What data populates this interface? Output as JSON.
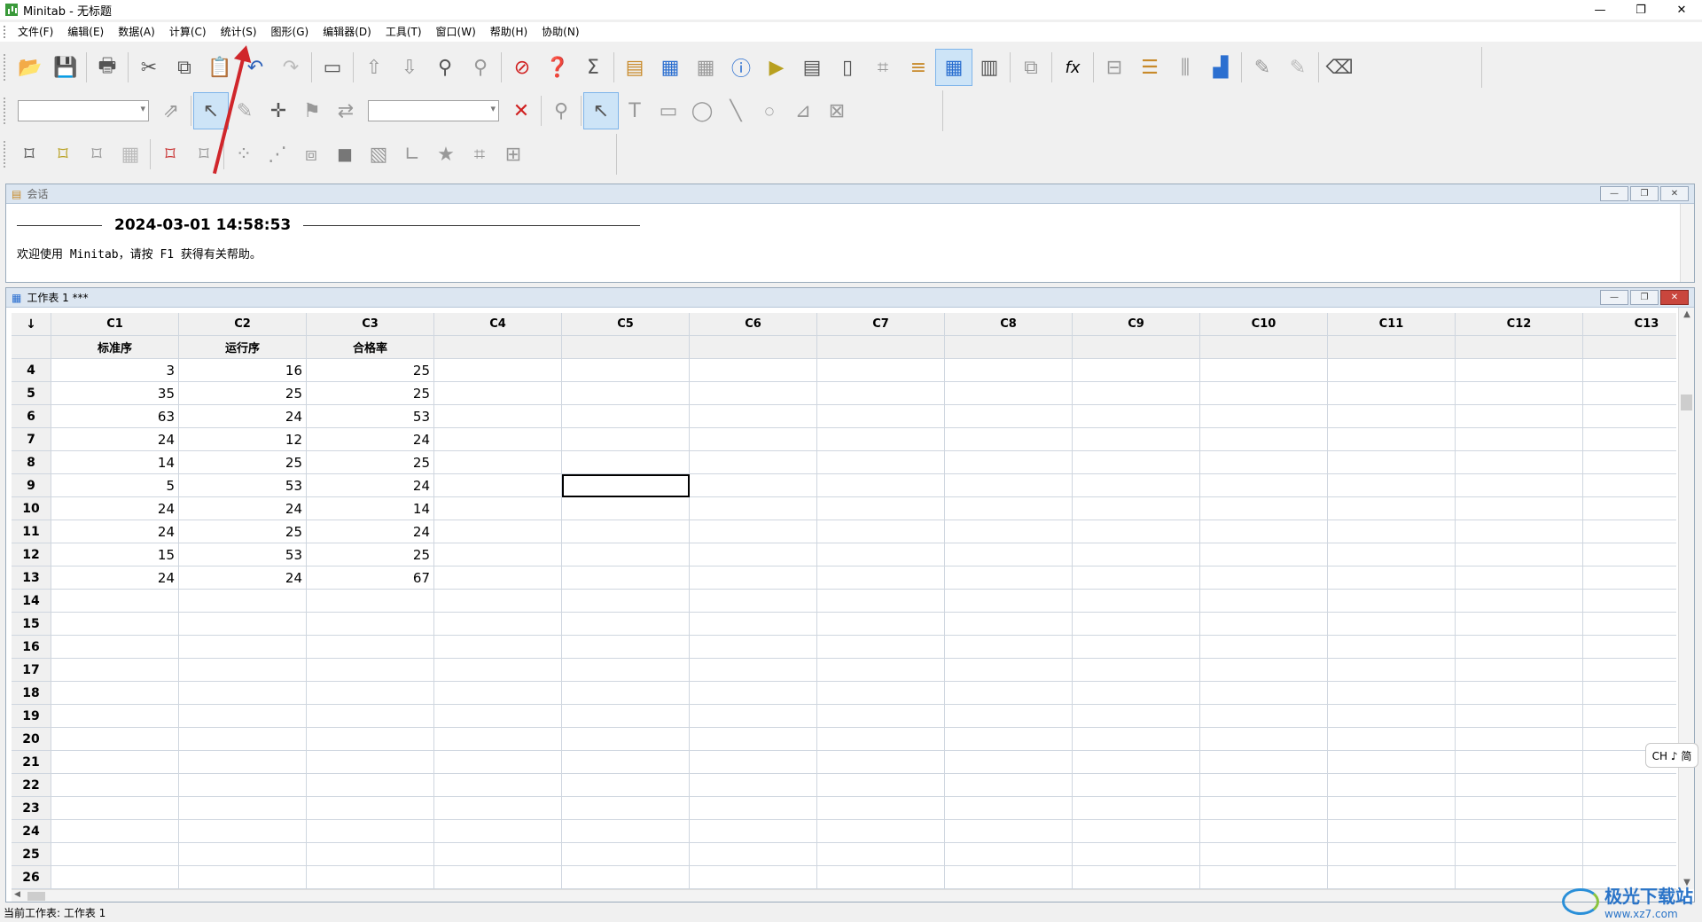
{
  "window": {
    "title": "Minitab - 无标题",
    "controls": [
      "—",
      "❐",
      "✕"
    ]
  },
  "menu": [
    "文件(F)",
    "编辑(E)",
    "数据(A)",
    "计算(C)",
    "统计(S)",
    "图形(G)",
    "编辑器(D)",
    "工具(T)",
    "窗口(W)",
    "帮助(H)",
    "协助(N)"
  ],
  "toolbar_icons": {
    "row1": [
      "open-icon",
      "save-icon",
      "print-icon",
      "cut-icon",
      "copy-icon",
      "paste-icon",
      "undo-icon",
      "redo-icon",
      "session-icon",
      "up-arrow-icon",
      "down-arrow-icon",
      "find-icon",
      "replace-icon",
      "cancel-icon",
      "help-icon",
      "stat-guide-icon",
      "assistant-icon",
      "windows-icon",
      "graph-folder-icon",
      "info-icon",
      "command-icon",
      "report-icon",
      "new-icon",
      "project-icon",
      "history-icon",
      "grid-icon",
      "layout-icon",
      "close-graphs-icon",
      "formula-icon",
      "split-icon",
      "align-left-icon",
      "bars-icon",
      "graph-chart-icon",
      "pen-icon",
      "pen-disabled-icon",
      "eraser-icon"
    ],
    "row2": [
      "brush-icon",
      "pointer-icon",
      "pencil-icon",
      "crosshair-icon",
      "flag-icon",
      "swap-icon",
      "delete-icon",
      "zoom-icon",
      "select-icon",
      "text-icon",
      "rectangle-icon",
      "ellipse-icon",
      "line-icon",
      "dot-icon",
      "polyline-icon",
      "polygon-icon"
    ],
    "row3": [
      "frame-icon",
      "frame-edit-icon",
      "frame-regions-icon",
      "grid-table-icon",
      "box-icon",
      "box-select-icon",
      "scatter-icon",
      "line-plot-icon",
      "cube-icon",
      "surface-icon",
      "layered-icon",
      "axes-icon",
      "star-icon",
      "crop-icon",
      "fit-icon"
    ]
  },
  "session": {
    "title": "会话",
    "datetime": "2024-03-01 14:58:53",
    "welcome": "欢迎使用 Minitab，请按 F1 获得有关帮助。"
  },
  "worksheet": {
    "title": "工作表 1 ***",
    "columns": [
      "C1",
      "C2",
      "C3",
      "C4",
      "C5",
      "C6",
      "C7",
      "C8",
      "C9",
      "C10",
      "C11",
      "C12",
      "C13"
    ],
    "column_names": [
      "标准序",
      "运行序",
      "合格率",
      "",
      "",
      "",
      "",
      "",
      "",
      "",
      "",
      "",
      ""
    ],
    "rows": [
      {
        "n": "4",
        "v": [
          "3",
          "16",
          "25"
        ]
      },
      {
        "n": "5",
        "v": [
          "35",
          "25",
          "25"
        ]
      },
      {
        "n": "6",
        "v": [
          "63",
          "24",
          "53"
        ]
      },
      {
        "n": "7",
        "v": [
          "24",
          "12",
          "24"
        ]
      },
      {
        "n": "8",
        "v": [
          "14",
          "25",
          "25"
        ]
      },
      {
        "n": "9",
        "v": [
          "5",
          "53",
          "24"
        ]
      },
      {
        "n": "10",
        "v": [
          "24",
          "24",
          "14"
        ]
      },
      {
        "n": "11",
        "v": [
          "24",
          "25",
          "24"
        ]
      },
      {
        "n": "12",
        "v": [
          "15",
          "53",
          "25"
        ]
      },
      {
        "n": "13",
        "v": [
          "24",
          "24",
          "67"
        ]
      },
      {
        "n": "14",
        "v": [
          "",
          "",
          ""
        ]
      },
      {
        "n": "15",
        "v": [
          "",
          "",
          ""
        ]
      },
      {
        "n": "16",
        "v": [
          "",
          "",
          ""
        ]
      },
      {
        "n": "17",
        "v": [
          "",
          "",
          ""
        ]
      },
      {
        "n": "18",
        "v": [
          "",
          "",
          ""
        ]
      },
      {
        "n": "19",
        "v": [
          "",
          "",
          ""
        ]
      },
      {
        "n": "20",
        "v": [
          "",
          "",
          ""
        ]
      },
      {
        "n": "21",
        "v": [
          "",
          "",
          ""
        ]
      },
      {
        "n": "22",
        "v": [
          "",
          "",
          ""
        ]
      },
      {
        "n": "23",
        "v": [
          "",
          "",
          ""
        ]
      },
      {
        "n": "24",
        "v": [
          "",
          "",
          ""
        ]
      },
      {
        "n": "25",
        "v": [
          "",
          "",
          ""
        ]
      },
      {
        "n": "26",
        "v": [
          "",
          "",
          ""
        ]
      }
    ],
    "selected_cell": {
      "row": "9",
      "col": "C5"
    }
  },
  "ime": "CH ♪ 简",
  "status": "当前工作表: 工作表 1",
  "watermark": {
    "name": "极光下载站",
    "url": "www.xz7.com"
  },
  "colors": {
    "annotation": "#d0262b",
    "mdi_title": "#dce6f1",
    "close_btn": "#c9463d"
  }
}
